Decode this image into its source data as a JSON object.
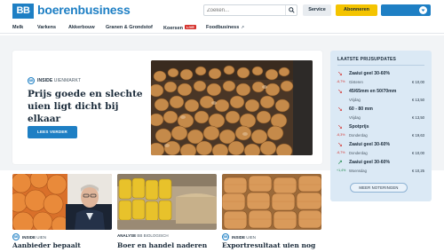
{
  "header": {
    "logo_mark": "BB",
    "logo_text": "boerenbusiness",
    "search_placeholder": "Zoeken...",
    "service_label": "Service",
    "subscribe_label": "Abonneren"
  },
  "nav": {
    "items": [
      {
        "label": "Melk"
      },
      {
        "label": "Varkens"
      },
      {
        "label": "Akkerbouw"
      },
      {
        "label": "Granen & Grondstof"
      },
      {
        "label": "Koersen",
        "badge": "LIVE"
      },
      {
        "label": "Foodbusiness"
      }
    ]
  },
  "hero": {
    "category": "INSIDE",
    "subcategory": "UIENMARKT",
    "title": "Prijs goede en slechte uien ligt dicht bij elkaar",
    "button_label": "LEES VERDER"
  },
  "prices": {
    "title": "LAATSTE PRIJSUPDATES",
    "more_label": "MEER NOTERINGEN",
    "rows": [
      {
        "name": "Zaaiui geel 30-60%",
        "change": "-6,7%",
        "direction": "down",
        "day": "Gisteren",
        "value": "€ 10,00"
      },
      {
        "name": "45/65mm en 50/70mm",
        "change": "",
        "direction": "down",
        "day": "Vrijdag",
        "value": "€ 13,50"
      },
      {
        "name": "60 - 80 mm",
        "change": "",
        "direction": "down",
        "day": "Vrijdag",
        "value": "€ 13,50"
      },
      {
        "name": "Spotprijs",
        "change": "-6,3%",
        "direction": "down",
        "day": "Donderdag",
        "value": "€ 19,63"
      },
      {
        "name": "Zaaiui geel 30-60%",
        "change": "-6,7%",
        "direction": "down",
        "day": "Donderdag",
        "value": "€ 10,00"
      },
      {
        "name": "Zaaiui geel 30-60%",
        "change": "+1,4%",
        "direction": "up",
        "day": "Woensdag",
        "value": "€ 10,25"
      }
    ]
  },
  "cards": [
    {
      "category": "INSIDE",
      "subcategory": "UIEN",
      "title": "Aanbieder bepaalt"
    },
    {
      "category": "ANALYSE",
      "subcategory": "BB BIOLOGISCH",
      "title": "Boer en handel naderen"
    },
    {
      "category": "INSIDE",
      "subcategory": "UIEN",
      "title": "Exportresultaat uien nog"
    }
  ],
  "colors": {
    "brand_blue": "#1e7fc4",
    "accent_yellow": "#f4c400",
    "price_panel": "#dbe9f5",
    "down": "#d5302b",
    "up": "#1f8a4c"
  }
}
